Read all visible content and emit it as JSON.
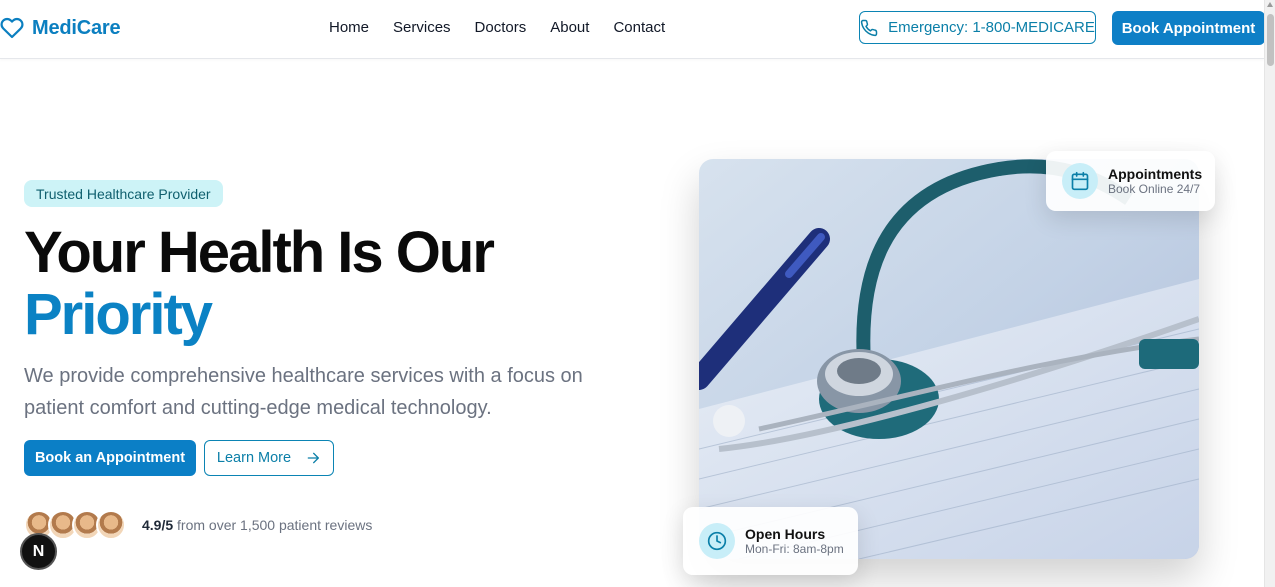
{
  "nav": {
    "brand": "MediCare",
    "links": [
      "Home",
      "Services",
      "Doctors",
      "About",
      "Contact"
    ],
    "emergency": "Emergency: 1-800-MEDICARE",
    "book": "Book Appointment"
  },
  "hero": {
    "badge": "Trusted Healthcare Provider",
    "headline_line1": "Your Health Is Our",
    "headline_line2": "Priority",
    "subtext": "We provide comprehensive healthcare services with a focus on patient comfort and cutting-edge medical technology.",
    "cta_primary": "Book an Appointment",
    "cta_secondary": "Learn More",
    "rating": "4.9/5",
    "rating_suffix": "from over 1,500 patient reviews"
  },
  "cards": {
    "appointments": {
      "title": "Appointments",
      "sub": "Book Online 24/7"
    },
    "hours": {
      "title": "Open Hours",
      "sub": "Mon-Fri: 8am-8pm"
    }
  },
  "badge_letter": "N",
  "colors": {
    "brand": "#0b7fc6",
    "accent_text": "#0b82c4",
    "badge_bg": "#cdf3f7"
  }
}
